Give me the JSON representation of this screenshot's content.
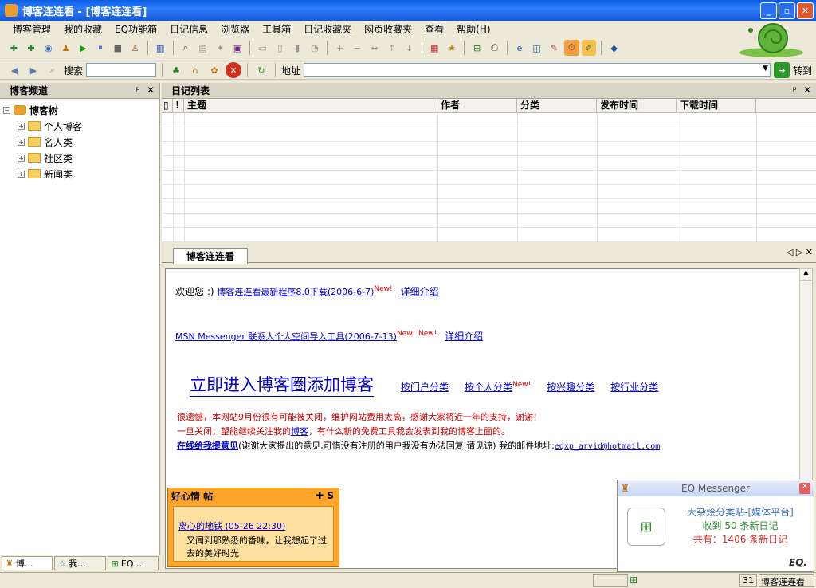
{
  "window": {
    "title": "博客连连看 - [博客连连看]",
    "minimize": "_",
    "maximize": "▫",
    "close": "✕"
  },
  "menu": [
    "博客管理",
    "我的收藏",
    "EQ功能箱",
    "日记信息",
    "浏览器",
    "工具箱",
    "日记收藏夹",
    "网页收藏夹",
    "查看",
    "帮助(H)"
  ],
  "addressbar": {
    "search_label": "搜索",
    "address_label": "地址",
    "go_label": "转到"
  },
  "left_panel": {
    "title": "博客频道",
    "pin": "ᵖ",
    "close": "✕",
    "root": "博客树",
    "items": [
      "个人博客",
      "名人类",
      "社区类",
      "新闻类"
    ],
    "tabs": [
      "博...",
      "我...",
      "EQ..."
    ]
  },
  "diary_list": {
    "title": "日记列表",
    "columns": [
      "主题",
      "作者",
      "分类",
      "发布时间",
      "下载时间"
    ]
  },
  "browser": {
    "tab": "博客连连看",
    "nav": "◁ ▷ ✕"
  },
  "content": {
    "welcome": "欢迎您 :)",
    "link1": "博客连连看最新程序8.0下载(2006-6-7)",
    "new": "New!",
    "detail": "详细介绍",
    "link2": "MSN Messenger 联系人个人空间导入工具(2006-7-13)",
    "big_link": "立即进入博客圈添加博客",
    "cat_links": [
      "按门户分类",
      "按个人分类",
      "按兴趣分类",
      "按行业分类"
    ],
    "notice1": "很遗憾，本网站9月份很有可能被关闭，维护网站费用太高，感谢大家将近一年的支持，谢谢！",
    "notice2a": "一旦关闭，望能继续关注我的",
    "notice2_link": "博客",
    "notice2b": "，有什么新的免费工具我会发表到我的博客上面的。",
    "feedback_link": "在线给我提意见",
    "feedback_text": "(谢谢大家提出的意见,可惜没有注册的用户我没有办法回复,请见谅) 我的邮件地址:",
    "email": "eqxp_arvid@hotmail.com"
  },
  "note": {
    "title": "好心情 帖",
    "title_right": "✚ S",
    "post_title": "离心的地铁 (05-26 22:30)",
    "post_body": "又闻到那熟悉的香味，让我想起了过去的美好时光"
  },
  "messenger": {
    "title": "EQ Messenger",
    "line1": "大杂烩分类贴-[媒体平台]",
    "line2": "收到 50 条新日记",
    "line3": "共有：1406 条新日记",
    "logo": "EQ."
  },
  "status": {
    "count": "31",
    "task": "博客连连看"
  },
  "colors": {
    "title_blue": "#0a5fe6",
    "link": "#0000cc",
    "notice_red": "#cc0000",
    "note_orange": "#ffa62a"
  }
}
